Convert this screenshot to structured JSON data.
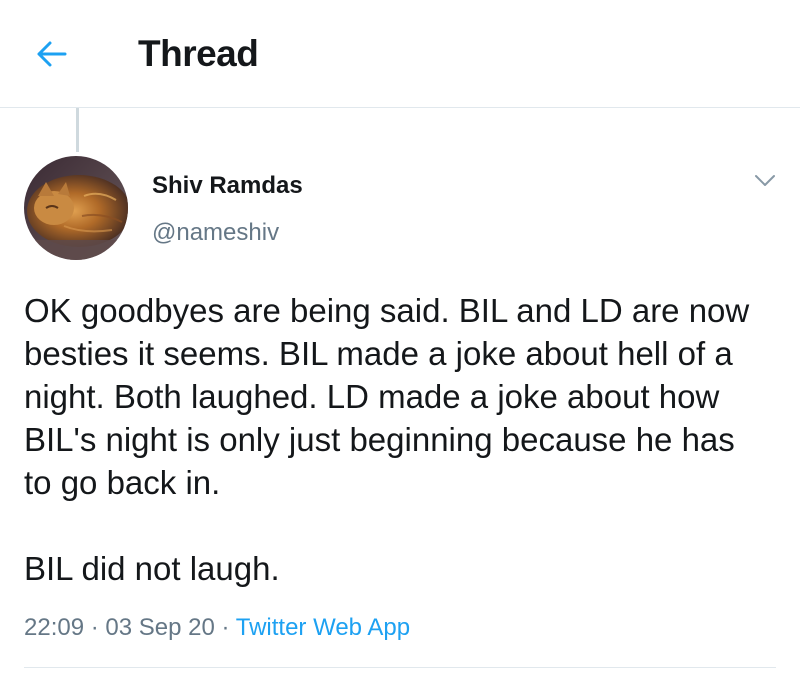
{
  "header": {
    "back_icon": "arrow-left-icon",
    "title": "Thread"
  },
  "tweet": {
    "author_name": "Shiv Ramdas",
    "author_handle": "@nameshiv",
    "avatar": "cat-photo-avatar",
    "menu_icon": "chevron-down-icon",
    "paragraphs": [
      "OK goodbyes are being said. BIL and LD are now besties it seems. BIL made a joke about hell of a night. Both laughed. LD made a joke about how BIL's night is only just beginning because he has to go back in.",
      "BIL did not laugh."
    ],
    "time": "22:09",
    "separator": "·",
    "date": "03 Sep 20",
    "source": "Twitter Web App"
  },
  "colors": {
    "accent": "#1da1f2",
    "text": "#14171a",
    "secondary_text": "#657786",
    "divider": "#e1e8ed"
  }
}
